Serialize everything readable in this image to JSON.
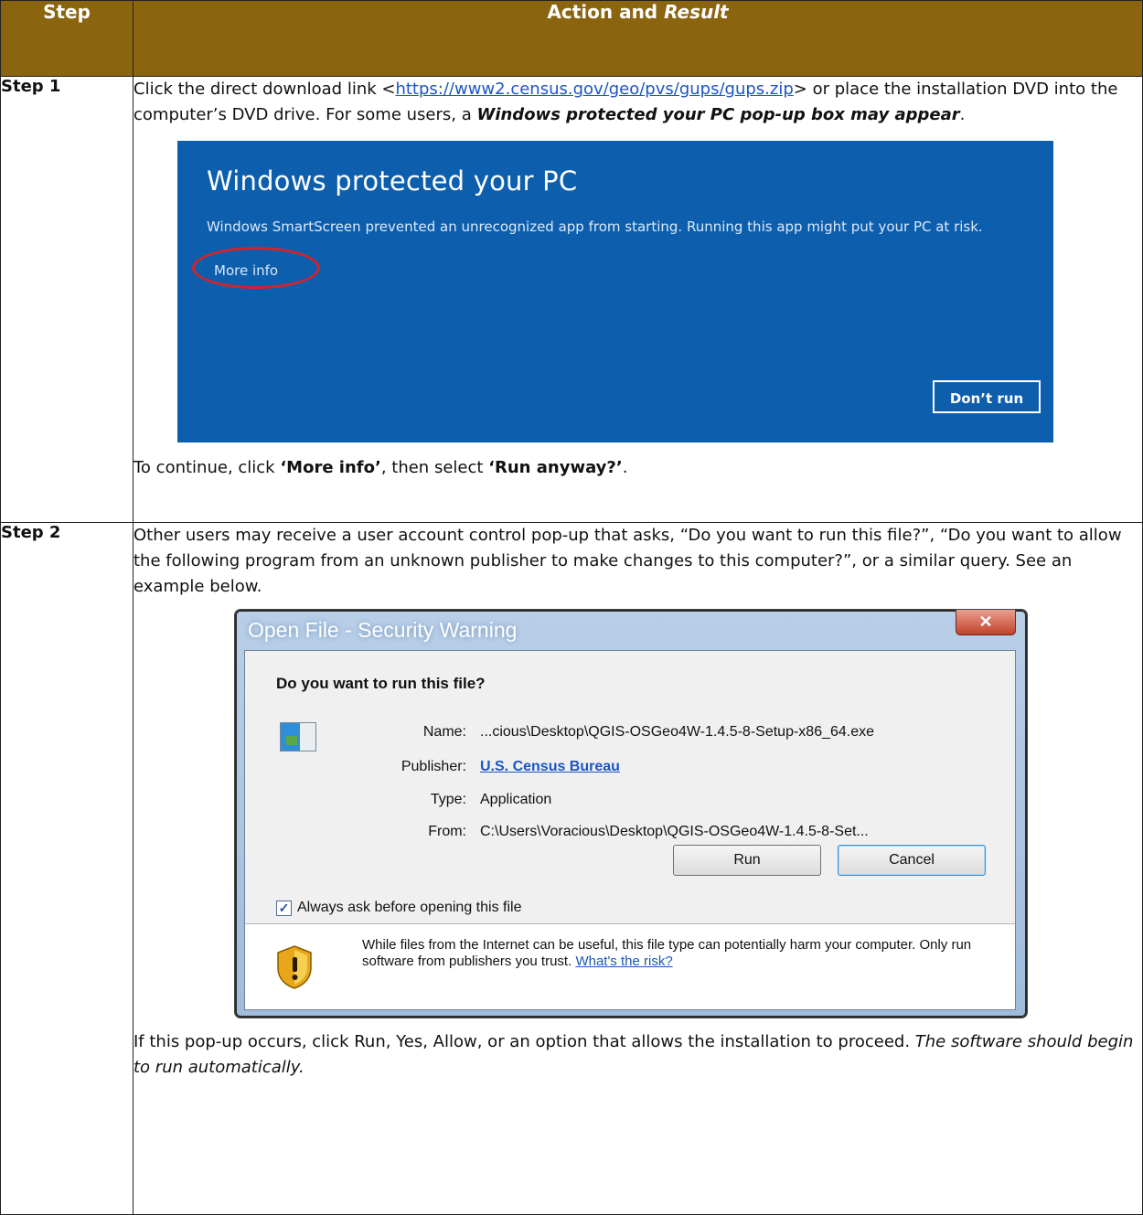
{
  "table": {
    "header": {
      "step": "Step",
      "action_prefix": "Action and ",
      "action_italic": "Result"
    },
    "step1": {
      "label": "Step 1",
      "p1_a": "Click the direct download link <",
      "p1_link": "https://www2.census.gov/geo/pvs/gups/gups.zip",
      "p1_b": "> or place the installation DVD into the computer’s DVD drive. For some users, a ",
      "p1_bi": "Windows protected your PC pop-up box may appear",
      "p1_c": ".",
      "p2_a": "To continue, click ",
      "p2_b1": "‘More info’",
      "p2_b": ", then select ",
      "p2_b2": "‘Run anyway?’",
      "p2_c": "."
    },
    "step2": {
      "label": "Step 2",
      "p1": "Other users may receive a user account control pop-up that asks, “Do you want to run this file?”, “Do you want to allow the following program from an unknown publisher to make changes to this computer?”, or a similar query. See an example below.",
      "p2_a": "If this pop-up occurs, click Run, Yes, Allow, or an option that allows the installation to proceed. ",
      "p2_i": "The software should begin to run automatically."
    }
  },
  "smartscreen": {
    "title": "Windows protected your PC",
    "message": "Windows SmartScreen prevented an unrecognized app from starting. Running this app might put your PC at risk.",
    "more_info": "More info",
    "dont_run": "Don’t run",
    "bg_color": "#0d5fad"
  },
  "security_warning": {
    "title": "Open File - Security Warning",
    "question": "Do you want to run this file?",
    "fields": [
      {
        "label": "Name:",
        "value": "...cious\\Desktop\\QGIS-OSGeo4W-1.4.5-8-Setup-x86_64.exe"
      },
      {
        "label": "Publisher:",
        "value": "U.S. Census Bureau"
      },
      {
        "label": "Type:",
        "value": "Application"
      },
      {
        "label": "From:",
        "value": "C:\\Users\\Voracious\\Desktop\\QGIS-OSGeo4W-1.4.5-8-Set..."
      }
    ],
    "run": "Run",
    "cancel": "Cancel",
    "checkbox_label": "Always ask before opening this file",
    "checkbox_checked": true,
    "warning_text": "While files from the Internet can be useful, this file type can potentially harm your computer. Only run software from publishers you trust. ",
    "risk_link": "What's the risk?"
  }
}
